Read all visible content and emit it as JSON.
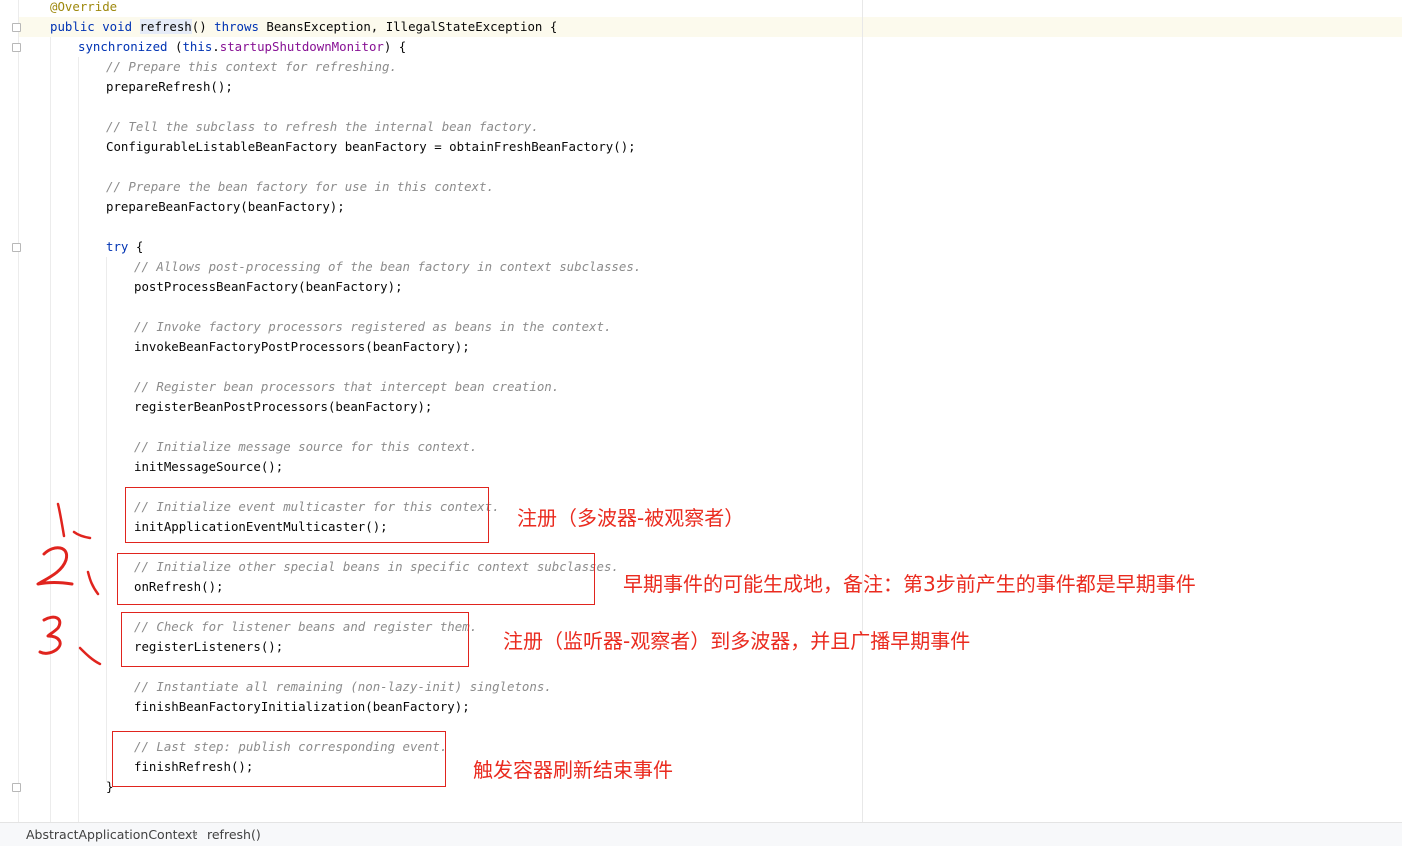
{
  "editor": {
    "lines": [
      {
        "tokens": [
          {
            "t": "@Override",
            "c": "ann"
          }
        ]
      },
      {
        "tokens": [
          {
            "t": "public void ",
            "c": "kw"
          },
          {
            "t": "refresh",
            "c": "hl",
            "caret": true
          },
          {
            "t": "() "
          },
          {
            "t": "throws ",
            "c": "kw"
          },
          {
            "t": "BeansException, IllegalStateException {"
          }
        ]
      },
      {
        "tokens": [
          {
            "t": "synchronized ",
            "c": "kw"
          },
          {
            "t": "("
          },
          {
            "t": "this",
            "c": "kw"
          },
          {
            "t": "."
          },
          {
            "t": "startupShutdownMonitor",
            "c": "fld"
          },
          {
            "t": ") {"
          }
        ]
      },
      {
        "tokens": [
          {
            "t": "// Prepare this context for refreshing.",
            "c": "cmt"
          }
        ]
      },
      {
        "tokens": [
          {
            "t": "prepareRefresh();"
          }
        ]
      },
      {
        "tokens": []
      },
      {
        "tokens": [
          {
            "t": "// Tell the subclass to refresh the internal bean factory.",
            "c": "cmt"
          }
        ]
      },
      {
        "tokens": [
          {
            "t": "ConfigurableListableBeanFactory beanFactory = obtainFreshBeanFactory();"
          }
        ]
      },
      {
        "tokens": []
      },
      {
        "tokens": [
          {
            "t": "// Prepare the bean factory for use in this context.",
            "c": "cmt"
          }
        ]
      },
      {
        "tokens": [
          {
            "t": "prepareBeanFactory(beanFactory);"
          }
        ]
      },
      {
        "tokens": []
      },
      {
        "tokens": [
          {
            "t": "try ",
            "c": "kw"
          },
          {
            "t": "{"
          }
        ]
      },
      {
        "tokens": [
          {
            "t": "// Allows post-processing of the bean factory in context subclasses.",
            "c": "cmt"
          }
        ]
      },
      {
        "tokens": [
          {
            "t": "postProcessBeanFactory(beanFactory);"
          }
        ]
      },
      {
        "tokens": []
      },
      {
        "tokens": [
          {
            "t": "// Invoke factory processors registered as beans in the context.",
            "c": "cmt"
          }
        ]
      },
      {
        "tokens": [
          {
            "t": "invokeBeanFactoryPostProcessors(beanFactory);"
          }
        ]
      },
      {
        "tokens": []
      },
      {
        "tokens": [
          {
            "t": "// Register bean processors that intercept bean creation.",
            "c": "cmt"
          }
        ]
      },
      {
        "tokens": [
          {
            "t": "registerBeanPostProcessors(beanFactory);"
          }
        ]
      },
      {
        "tokens": []
      },
      {
        "tokens": [
          {
            "t": "// Initialize message source for this context.",
            "c": "cmt"
          }
        ]
      },
      {
        "tokens": [
          {
            "t": "initMessageSource();"
          }
        ]
      },
      {
        "tokens": []
      },
      {
        "tokens": [
          {
            "t": "// Initialize event multicaster for this context.",
            "c": "cmt"
          }
        ]
      },
      {
        "tokens": [
          {
            "t": "initApplicationEventMulticaster();"
          }
        ]
      },
      {
        "tokens": []
      },
      {
        "tokens": [
          {
            "t": "// Initialize other special beans in specific context subclasses.",
            "c": "cmt"
          }
        ]
      },
      {
        "tokens": [
          {
            "t": "onRefresh();"
          }
        ]
      },
      {
        "tokens": []
      },
      {
        "tokens": [
          {
            "t": "// Check for listener beans and register them.",
            "c": "cmt"
          }
        ]
      },
      {
        "tokens": [
          {
            "t": "registerListeners();"
          }
        ]
      },
      {
        "tokens": []
      },
      {
        "tokens": [
          {
            "t": "// Instantiate all remaining (non-lazy-init) singletons.",
            "c": "cmt"
          }
        ]
      },
      {
        "tokens": [
          {
            "t": "finishBeanFactoryInitialization(beanFactory);"
          }
        ]
      },
      {
        "tokens": []
      },
      {
        "tokens": [
          {
            "t": "// Last step: publish corresponding event.",
            "c": "cmt"
          }
        ]
      },
      {
        "tokens": [
          {
            "t": "finishRefresh();"
          }
        ]
      },
      {
        "tokens": [
          {
            "t": "}"
          }
        ]
      }
    ]
  },
  "annotations": {
    "note1": "注册（多波器-被观察者）",
    "note2": "早期事件的可能生成地，备注：第3步前产生的事件都是早期事件",
    "note3": "注册（监听器-观察者）到多波器，并且广播早期事件",
    "note4": "触发容器刷新结束事件",
    "step1": "1.",
    "step2": "2.",
    "step3": "3."
  },
  "breadcrumb": {
    "class_name": "AbstractApplicationContext",
    "method_name": "refresh()"
  },
  "colors": {
    "keyword": "#0033b3",
    "annotation": "#9e880d",
    "field": "#871094",
    "comment": "#8c8c8c",
    "markup_red": "#e0241e"
  }
}
